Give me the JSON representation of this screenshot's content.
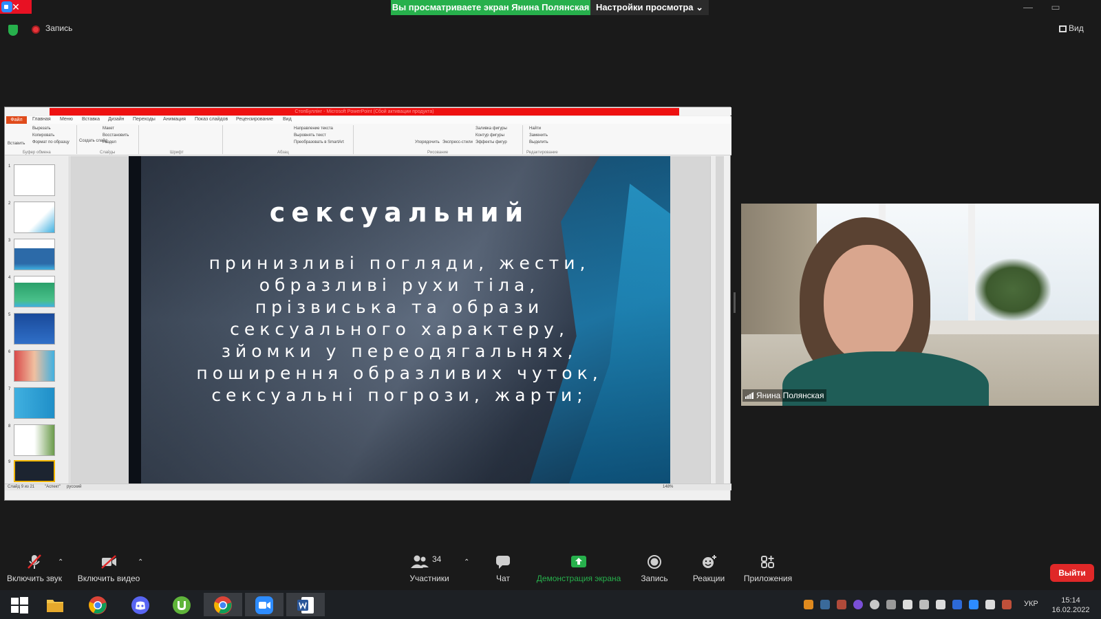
{
  "zoom": {
    "share_banner": "Вы просматриваете экран Янина Полянская",
    "view_options": "Настройки просмотра",
    "recording_label": "Запись",
    "view_label": "Вид",
    "window_close": "✕",
    "window_min": "—",
    "window_max": "▭"
  },
  "powerpoint": {
    "title": "СтопБуллінг - Microsoft PowerPoint (Сбой активации продукта)",
    "file_tab": "Файл",
    "tabs": [
      "Главная",
      "Меню",
      "Вставка",
      "Дизайн",
      "Переходы",
      "Анимация",
      "Показ слайдов",
      "Рецензирование",
      "Вид"
    ],
    "clipboard": {
      "paste": "Вставить",
      "cut": "Вырезать",
      "copy": "Копировать",
      "format_painter": "Формат по образцу",
      "group": "Буфер обмена"
    },
    "slides_group": {
      "new_slide": "Создать слайд",
      "layout": "Макет",
      "reset": "Восстановить",
      "section": "Раздел",
      "group": "Слайды"
    },
    "font_group": "Шрифт",
    "paragraph": {
      "text_direction": "Направление текста",
      "align_text": "Выровнять текст",
      "convert_smartart": "Преобразовать в SmartArt",
      "group": "Абзац"
    },
    "drawing": {
      "arrange": "Упорядочить",
      "quick_styles": "Экспресс-стили",
      "shape_fill": "Заливка фигуры",
      "shape_outline": "Контур фигуры",
      "shape_effects": "Эффекты фигур",
      "group": "Рисование"
    },
    "editing": {
      "find": "Найти",
      "replace": "Заменить",
      "select": "Выделить",
      "group": "Редактирование"
    },
    "thumbnails": [
      "1",
      "2",
      "3",
      "4",
      "5",
      "6",
      "7",
      "8",
      "9"
    ],
    "slide": {
      "title": "сексуальний",
      "lines": [
        "принизливі погляди, жести,",
        "образливі рухи тіла,",
        "прізвиська та образи",
        "сексуального характеру,",
        "зйомки у переодягальнях,",
        "поширення образливих чуток,",
        "сексуальні погрози, жарти;"
      ]
    },
    "status": {
      "slide_counter": "Слайд 9 из 21",
      "theme": "\"Аспект\"",
      "language": "русский",
      "zoom": "148%"
    }
  },
  "video": {
    "participant_name": "Янина Полянская"
  },
  "toolbar": {
    "mute": "Включить звук",
    "video": "Включить видео",
    "participants": "Участники",
    "participant_count": "34",
    "chat": "Чат",
    "share": "Демонстрация экрана",
    "record": "Запись",
    "reactions": "Реакции",
    "apps": "Приложения",
    "exit": "Выйти"
  },
  "taskbar": {
    "language": "УКР",
    "time": "15:14",
    "date": "16.02.2022"
  },
  "colors": {
    "share_green": "#27b04c",
    "exit_red": "#e02828",
    "ppt_red": "#ee1111",
    "file_tab": "#e04b1b"
  }
}
